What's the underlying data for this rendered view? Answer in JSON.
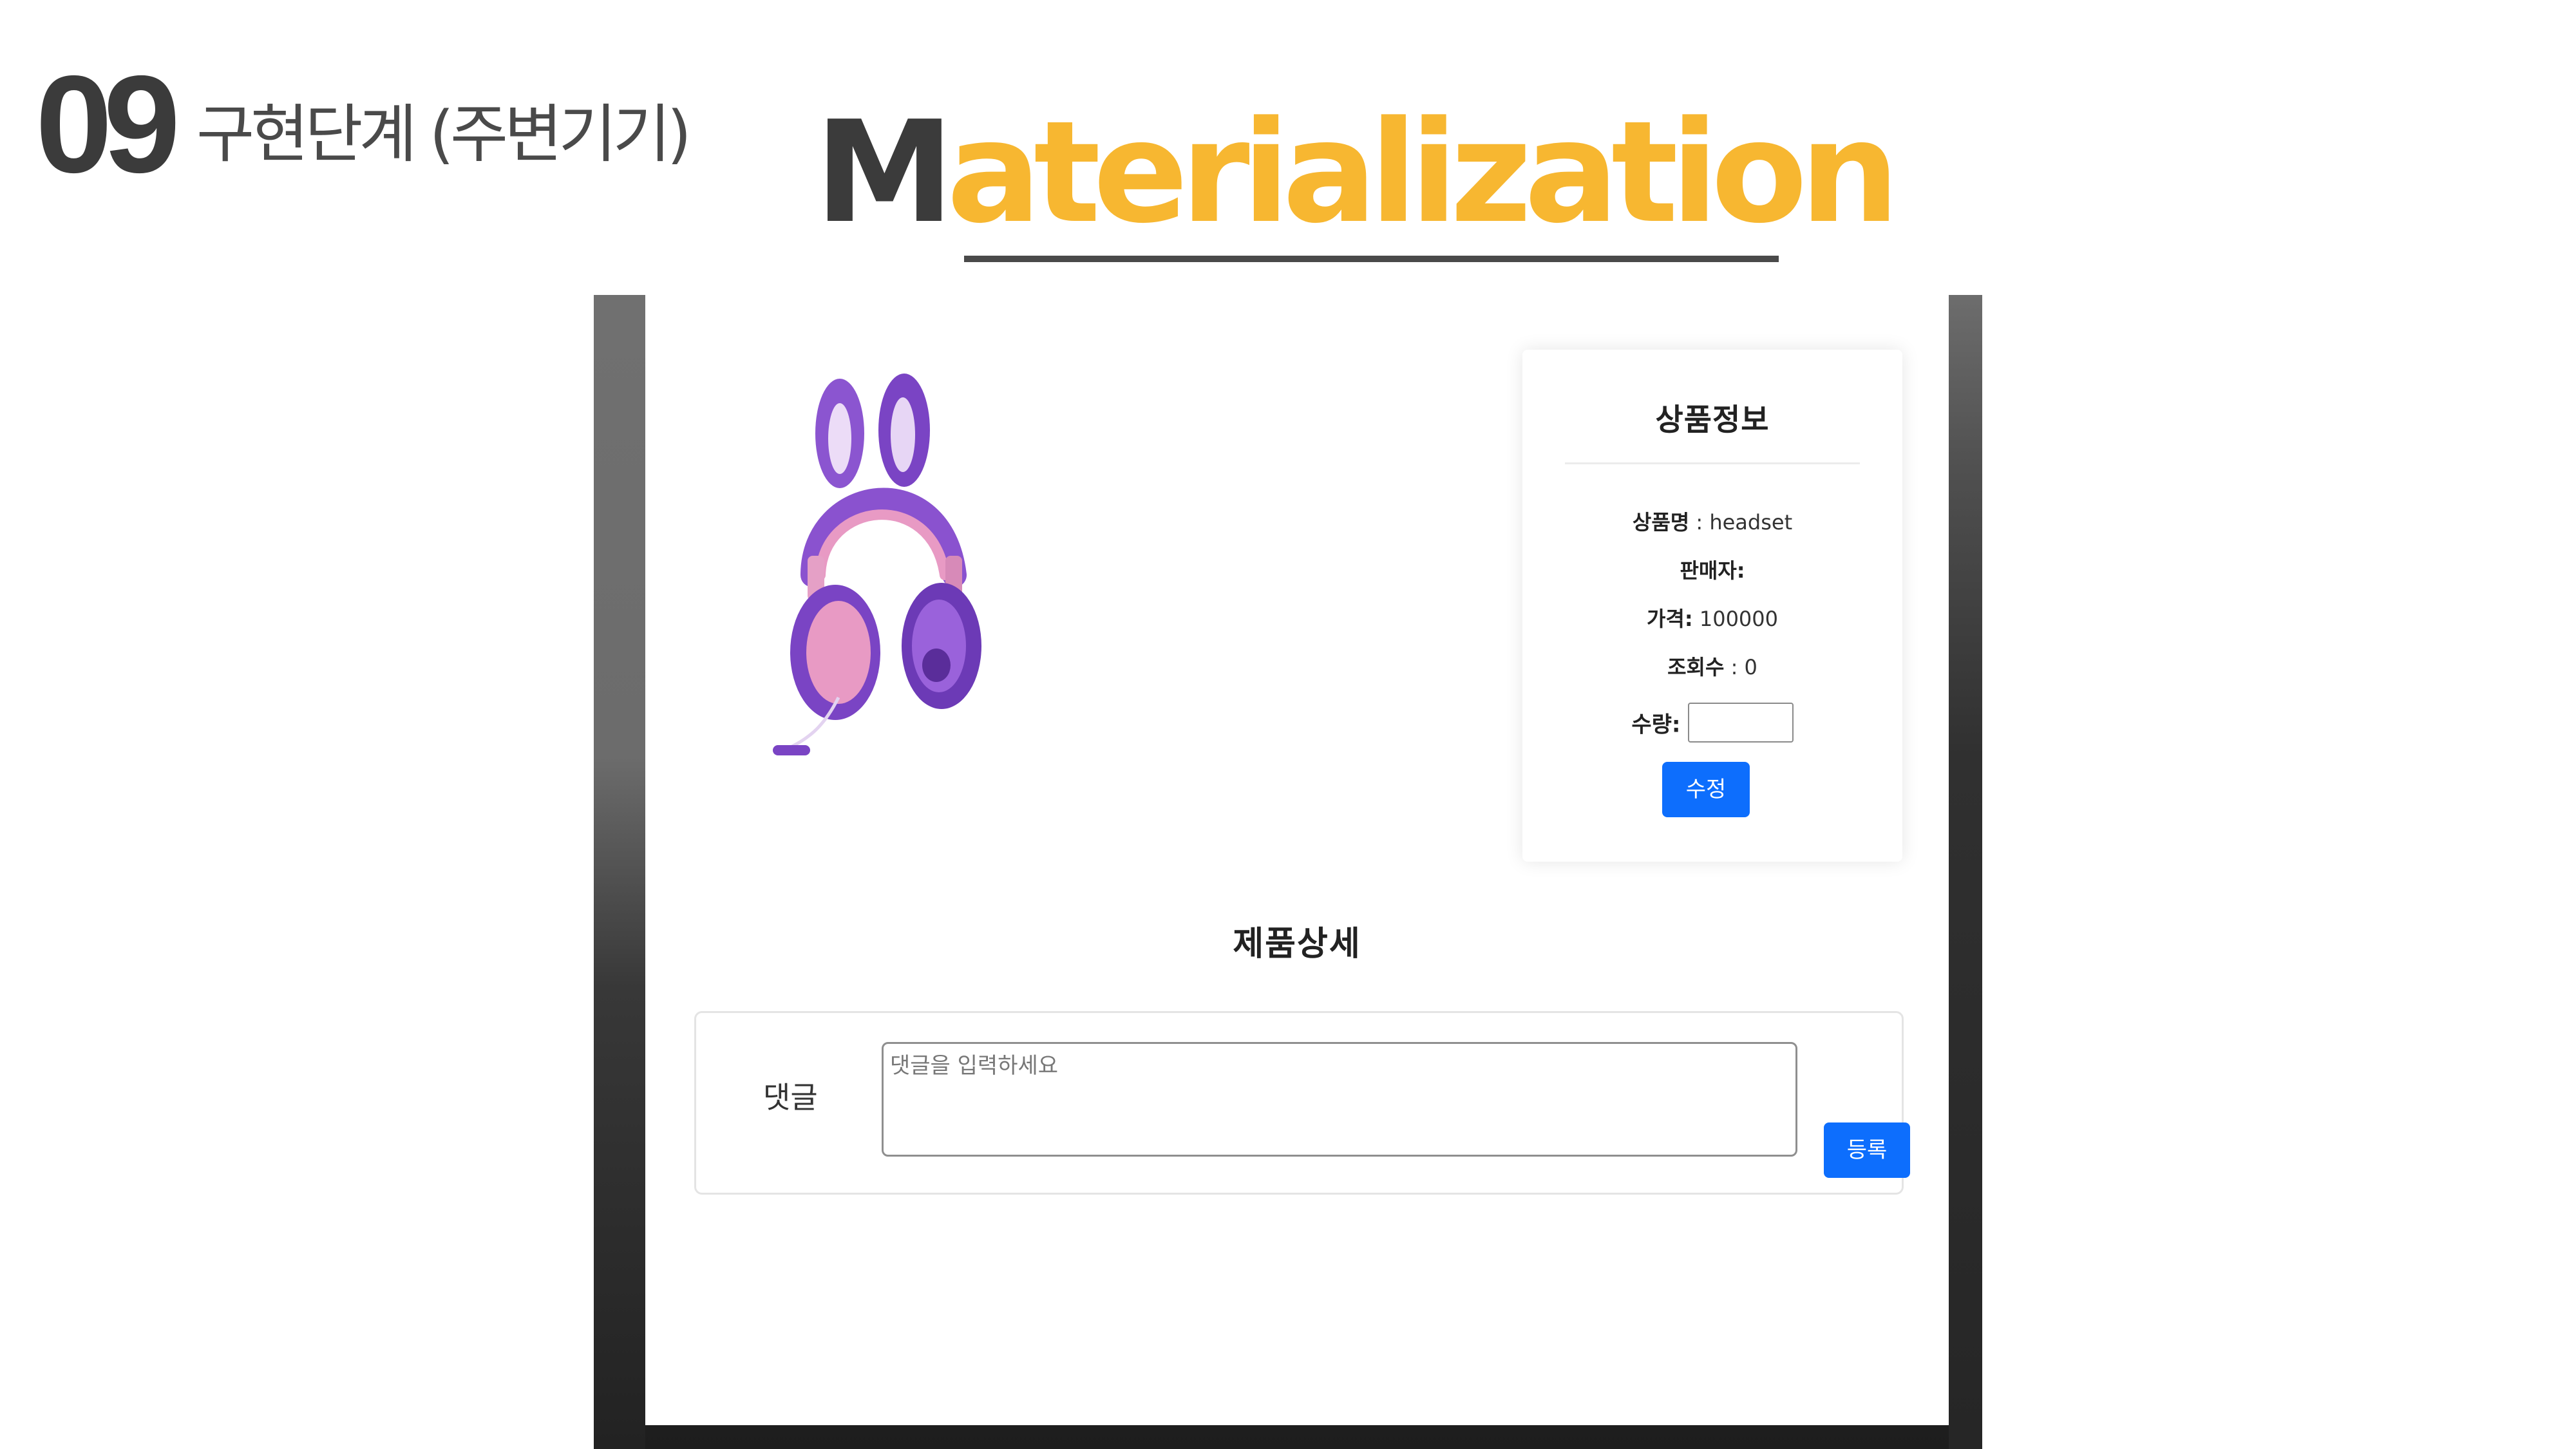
{
  "slide": {
    "number": "09",
    "subtitle": "구현단계 (주변기기)",
    "headline_first": "M",
    "headline_rest": "aterialization"
  },
  "product": {
    "image_name": "bunny-ear-headset-image",
    "colors": {
      "purple": "#7a4bc4",
      "pink": "#e89ac4"
    }
  },
  "info_card": {
    "title": "상품정보",
    "name_label": "상품명",
    "name_sep": " : ",
    "name_value": "headset",
    "seller_label": "판매자:",
    "seller_value": "",
    "price_label": "가격:",
    "price_value": "100000",
    "views_label": "조회수",
    "views_sep": " : ",
    "views_value": "0",
    "qty_label": "수량:",
    "qty_value": "",
    "edit_button": "수정"
  },
  "detail": {
    "title": "제품상세"
  },
  "comment": {
    "label": "댓글",
    "placeholder": "댓글을 입력하세요",
    "submit_button": "등록"
  },
  "colors": {
    "accent": "#f7b731",
    "dark": "#3b3b3b",
    "button": "#0d6efd"
  }
}
